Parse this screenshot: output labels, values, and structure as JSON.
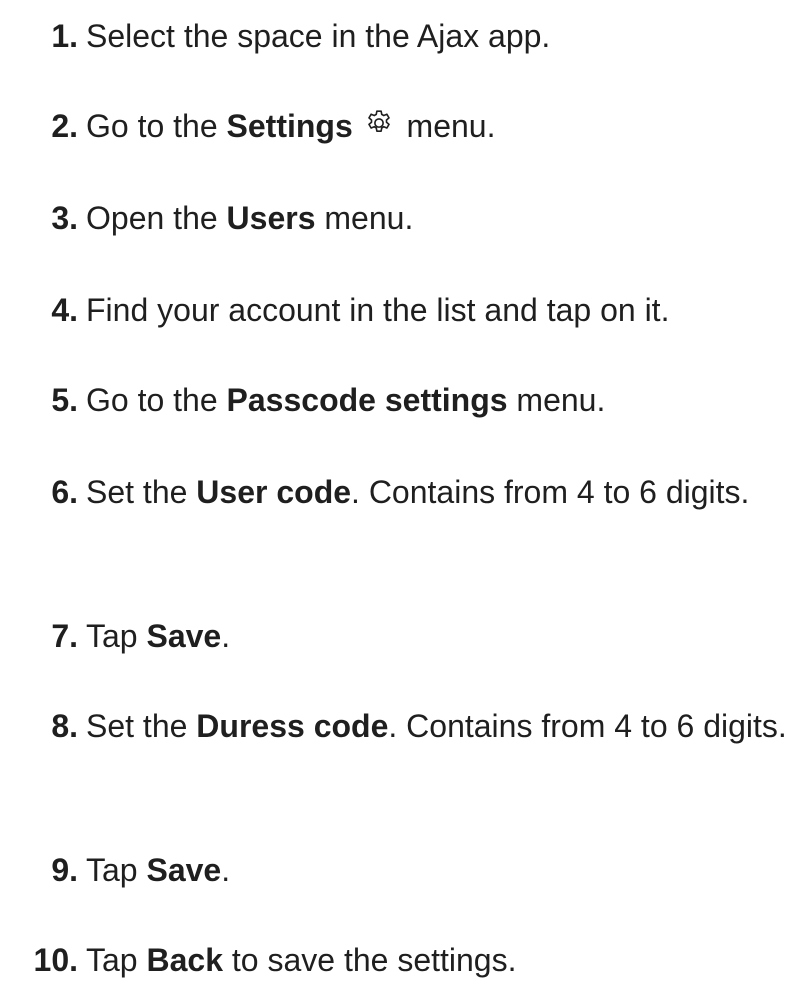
{
  "steps": [
    {
      "number": "1.",
      "parts": [
        {
          "text": "Select the space in the Ajax app.",
          "bold": false
        }
      ]
    },
    {
      "number": "2.",
      "parts": [
        {
          "text": "Go to the ",
          "bold": false
        },
        {
          "text": "Settings",
          "bold": true
        },
        {
          "icon": "gear-icon"
        },
        {
          "text": " menu.",
          "bold": false
        }
      ]
    },
    {
      "number": "3.",
      "parts": [
        {
          "text": "Open the ",
          "bold": false
        },
        {
          "text": "Users",
          "bold": true
        },
        {
          "text": " menu.",
          "bold": false
        }
      ]
    },
    {
      "number": "4.",
      "parts": [
        {
          "text": "Find your account in the list and tap on it.",
          "bold": false
        }
      ]
    },
    {
      "number": "5.",
      "parts": [
        {
          "text": "Go to the ",
          "bold": false
        },
        {
          "text": "Passcode settings",
          "bold": true
        },
        {
          "text": " menu.",
          "bold": false
        }
      ]
    },
    {
      "number": "6.",
      "parts": [
        {
          "text": "Set the ",
          "bold": false
        },
        {
          "text": "User code",
          "bold": true
        },
        {
          "text": ". Contains from 4 to 6 digits.",
          "bold": false
        }
      ]
    },
    {
      "number": "7.",
      "parts": [
        {
          "text": "Tap ",
          "bold": false
        },
        {
          "text": "Save",
          "bold": true
        },
        {
          "text": ".",
          "bold": false
        }
      ]
    },
    {
      "number": "8.",
      "parts": [
        {
          "text": "Set the ",
          "bold": false
        },
        {
          "text": "Duress code",
          "bold": true
        },
        {
          "text": ". Contains from 4 to 6 digits.",
          "bold": false
        }
      ]
    },
    {
      "number": "9.",
      "parts": [
        {
          "text": "Tap ",
          "bold": false
        },
        {
          "text": "Save",
          "bold": true
        },
        {
          "text": ".",
          "bold": false
        }
      ]
    },
    {
      "number": "10.",
      "parts": [
        {
          "text": "Tap ",
          "bold": false
        },
        {
          "text": "Back",
          "bold": true
        },
        {
          "text": " to save the settings.",
          "bold": false
        }
      ]
    }
  ],
  "colors": {
    "text": "#1f1f1f",
    "background": "#ffffff"
  }
}
